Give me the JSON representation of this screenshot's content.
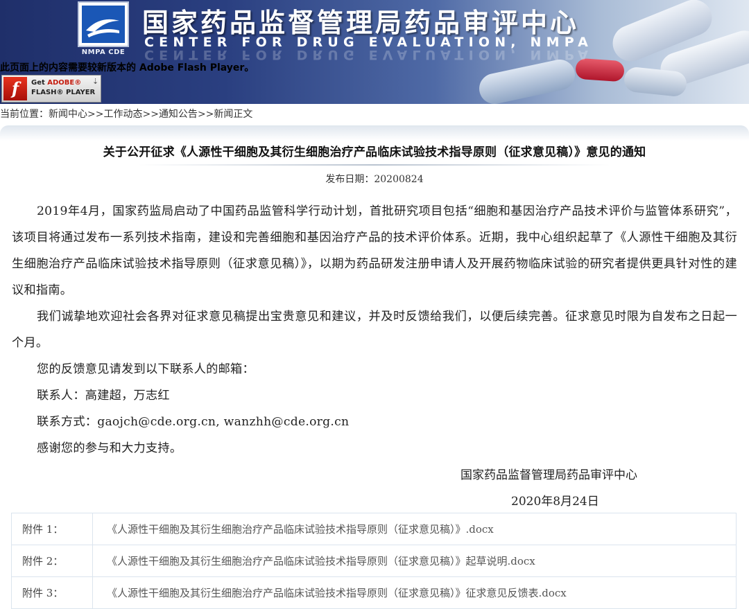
{
  "header": {
    "logo_caption": "NMPA CDE",
    "title_cn": "国家药品监督管理局药品审评中心",
    "title_en": "CENTER FOR DRUG EVALUATION, NMPA",
    "flash_notice": "此页面上的内容需要较新版本的 Adobe Flash Player。",
    "flash_badge_line1_prefix": "Get",
    "flash_badge_line1_brand": "ADOBE®",
    "flash_badge_line2": "FLASH® PLAYER",
    "download_icon": "download-arrow-icon"
  },
  "breadcrumb": {
    "label": "当前位置：",
    "items": [
      "新闻中心",
      "工作动态",
      "通知公告",
      "新闻正文"
    ],
    "separator": ">>"
  },
  "article": {
    "title": "关于公开征求《人源性干细胞及其衍生细胞治疗产品临床试验技术指导原则（征求意见稿）》意见的通知",
    "pubdate": "发布日期：20200824",
    "paragraphs": [
      "2019年4月，国家药监局启动了中国药品监管科学行动计划，首批研究项目包括“细胞和基因治疗产品技术评价与监管体系研究”，该项目将通过发布一系列技术指南，建设和完善细胞和基因治疗产品的技术评价体系。近期，我中心组织起草了《人源性干细胞及其衍生细胞治疗产品临床试验技术指导原则（征求意见稿）》，以期为药品研发注册申请人及开展药物临床试验的研究者提供更具针对性的建议和指南。",
      "我们诚挚地欢迎社会各界对征求意见稿提出宝贵意见和建议，并及时反馈给我们，以便后续完善。征求意见时限为自发布之日起一个月。",
      "您的反馈意见请发到以下联系人的邮箱：",
      "联系人：高建超，万志红",
      "联系方式：gaojch@cde.org.cn, wanzhh@cde.org.cn",
      "感谢您的参与和大力支持。"
    ],
    "signature": "国家药品监督管理局药品审评中心",
    "sign_date": "2020年8月24日"
  },
  "attachments": [
    {
      "label": "附件 1：",
      "file": "《人源性干细胞及其衍生细胞治疗产品临床试验技术指导原则（征求意见稿）》.docx"
    },
    {
      "label": "附件 2：",
      "file": "《人源性干细胞及其衍生细胞治疗产品临床试验技术指导原则（征求意见稿）》起草说明.docx"
    },
    {
      "label": "附件 3：",
      "file": "《人源性干细胞及其衍生细胞治疗产品临床试验技术指导原则（征求意见稿）》征求意见反馈表.docx"
    }
  ],
  "colors": {
    "banner_dark": "#1f2f6a",
    "banner_light": "#dfe7f1",
    "flash_red": "#c51c0f",
    "table_border": "#dbe4ee"
  }
}
